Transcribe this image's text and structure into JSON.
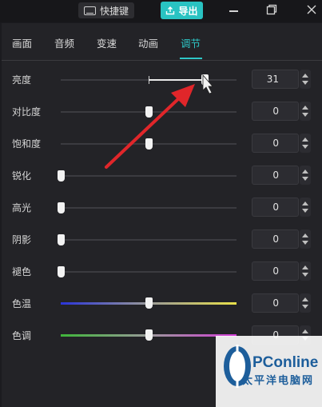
{
  "titlebar": {
    "shortcut_label": "快捷键",
    "export_label": "导出",
    "icons": [
      "keyboard-icon",
      "upload-icon",
      "minimize-icon",
      "maximize-icon",
      "close-icon"
    ]
  },
  "tabs": [
    {
      "label": "画面"
    },
    {
      "label": "音频"
    },
    {
      "label": "变速"
    },
    {
      "label": "动画"
    },
    {
      "label": "调节",
      "active": true
    }
  ],
  "adjustments": [
    {
      "label": "亮度",
      "value": "31",
      "level": 0.82
    },
    {
      "label": "对比度",
      "value": "0",
      "level": 0.5
    },
    {
      "label": "饱和度",
      "value": "0",
      "level": 0.5
    },
    {
      "label": "锐化",
      "value": "0",
      "level": 0.0
    },
    {
      "label": "高光",
      "value": "0",
      "level": 0.0
    },
    {
      "label": "阴影",
      "value": "0",
      "level": 0.0
    },
    {
      "label": "褪色",
      "value": "0",
      "level": 0.0
    },
    {
      "label": "色温",
      "value": "0",
      "level": 0.5
    },
    {
      "label": "色调",
      "value": "0",
      "level": 0.5
    }
  ],
  "colors": {
    "accent": "#2ec7c7",
    "temp_gradient": [
      "#2a34d8",
      "#e8e04a"
    ],
    "tint_gradient": [
      "#3fb53a",
      "#d23ed6"
    ],
    "annotation_arrow": "#e0262a"
  },
  "watermark": {
    "brand": "PConline",
    "sub": "太平洋电脑网"
  }
}
